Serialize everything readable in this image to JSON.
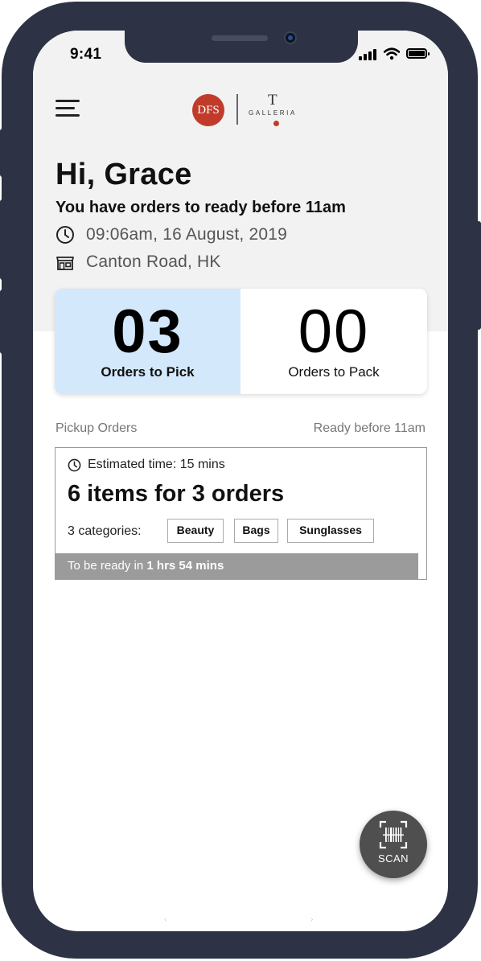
{
  "status_bar": {
    "time": "9:41"
  },
  "brand": {
    "logo_text": "DFS",
    "sub_logo_letter": "T",
    "sub_logo_text": "GALLERIA"
  },
  "header": {
    "greeting": "Hi, Grace",
    "subtitle": "You have orders to ready before 11am",
    "datetime": "09:06am, 16 August, 2019",
    "location": "Canton Road, HK"
  },
  "stats": {
    "pick": {
      "count": "03",
      "label": "Orders to Pick"
    },
    "pack": {
      "count": "00",
      "label": "Orders to Pack"
    }
  },
  "section": {
    "title": "Pickup Orders",
    "deadline": "Ready before 11am"
  },
  "order_card": {
    "estimated_time": "Estimated time: 15 mins",
    "headline": "6 items for 3 orders",
    "categories_label": "3 categories:",
    "categories": [
      "Beauty",
      "Bags",
      "Sunglasses"
    ],
    "ready_prefix": "To be ready in ",
    "ready_time": "1 hrs 54 mins"
  },
  "scan_button": {
    "label": "SCAN"
  },
  "colors": {
    "frame": "#2d3245",
    "accent_red": "#c13b2a",
    "pick_highlight": "#d3e8fa",
    "ready_bar": "#9b9b9b"
  }
}
